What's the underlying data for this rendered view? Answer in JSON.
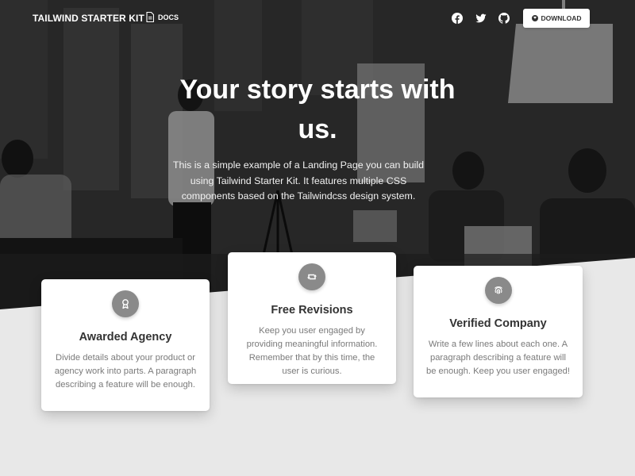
{
  "nav": {
    "brand": "TAILWIND STARTER KIT",
    "docs_label": "DOCS",
    "socials": [
      "facebook-icon",
      "twitter-icon",
      "github-icon"
    ],
    "download_label": "DOWNLOAD"
  },
  "hero": {
    "title": "Your story starts with us.",
    "text": "This is a simple example of a Landing Page you can build using Tailwind Starter Kit. It features multiple CSS components based on the Tailwindcss design system."
  },
  "features": [
    {
      "icon": "award-icon",
      "title": "Awarded Agency",
      "text": "Divide details about your product or agency work into parts. A paragraph describing a feature will be enough."
    },
    {
      "icon": "retweet-icon",
      "title": "Free Revisions",
      "text": "Keep you user engaged by providing meaningful information. Remember that by this time, the user is curious."
    },
    {
      "icon": "fingerprint-icon",
      "title": "Verified Company",
      "text": "Write a few lines about each one. A paragraph describing a feature will be enough. Keep you user engaged!"
    }
  ],
  "colors": {
    "hero_dark": "#2f2f2f",
    "badge": "#8a8a8a",
    "card_bg": "#ffffff",
    "page_bg": "#e8e8e8"
  }
}
